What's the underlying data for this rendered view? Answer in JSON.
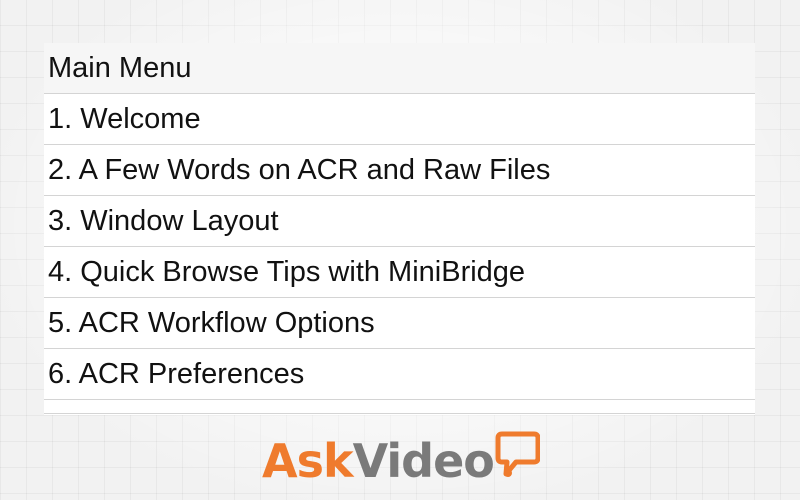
{
  "menu": {
    "title": "Main Menu",
    "items": [
      {
        "label": "1. Welcome"
      },
      {
        "label": "2. A Few Words on ACR and Raw Files"
      },
      {
        "label": "3. Window Layout"
      },
      {
        "label": "4. Quick Browse Tips with MiniBridge"
      },
      {
        "label": "5. ACR Workflow Options"
      },
      {
        "label": "6. ACR Preferences"
      }
    ]
  },
  "logo": {
    "ask": "Ask",
    "video": "Video",
    "icon": "speech-bubble-icon"
  },
  "colors": {
    "accent": "#ef7b2d",
    "logo_gray": "#7a7a7a"
  }
}
